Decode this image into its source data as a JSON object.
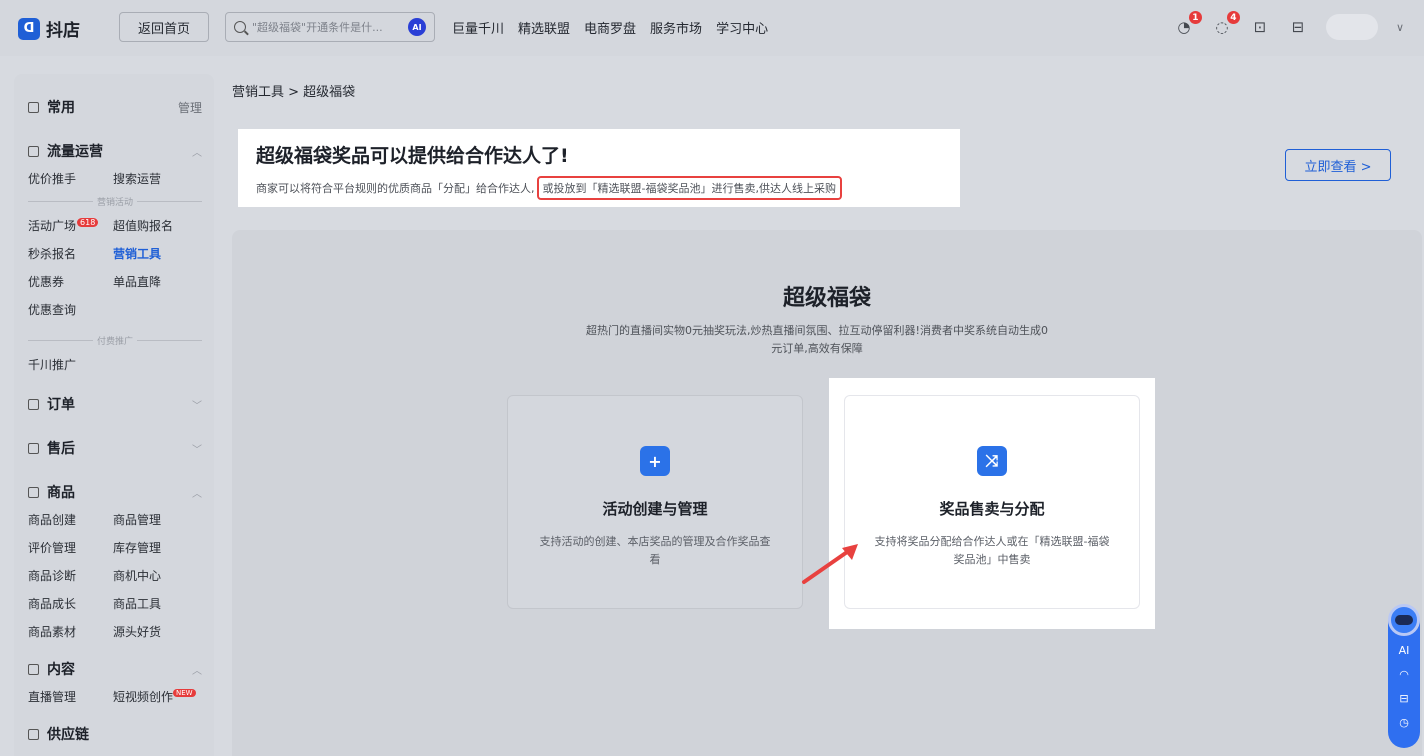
{
  "app": {
    "logo_text": "抖店",
    "logo_mark": "ᗡ",
    "home_label": "返回首页",
    "search_placeholder": "\"超级福袋\"开通条件是什...",
    "ai_label": "AI",
    "topnav": [
      "巨量千川",
      "精选联盟",
      "电商罗盘",
      "服务市场",
      "学习中心"
    ],
    "notification_counts": [
      "1",
      "4"
    ]
  },
  "sidebar": {
    "common": {
      "title": "常用",
      "action": "管理"
    },
    "traffic": {
      "title": "流量运营",
      "row1": [
        "优价推手",
        "搜索运营"
      ],
      "divider1": "营销活动",
      "row2": [
        "活动广场",
        "超值购报名"
      ],
      "badge618": "618",
      "row3": [
        "秒杀报名",
        "营销工具"
      ],
      "row4": [
        "优惠券",
        "单品直降"
      ],
      "row5": [
        "优惠查询"
      ],
      "divider2": "付费推广",
      "row6": [
        "千川推广"
      ]
    },
    "orders": {
      "title": "订单"
    },
    "aftersale": {
      "title": "售后"
    },
    "goods": {
      "title": "商品",
      "items": [
        "商品创建",
        "商品管理",
        "评价管理",
        "库存管理",
        "商品诊断",
        "商机中心",
        "商品成长",
        "商品工具",
        "商品素材",
        "源头好货"
      ]
    },
    "content": {
      "title": "内容",
      "items": [
        "直播管理",
        "短视频创作"
      ],
      "new_badge": "NEW"
    },
    "supply": {
      "title": "供应链"
    }
  },
  "main": {
    "breadcrumb": "营销工具 > 超级福袋",
    "banner": {
      "title": "超级福袋奖品可以提供给合作达人了!",
      "sub_prefix": "商家可以将符合平台规则的优质商品「分配」给合作达人,",
      "sub_highlight": "或投放到「精选联盟-福袋奖品池」进行售卖,供达人线上采购",
      "button": "立即查看 >"
    },
    "panel": {
      "title": "超级福袋",
      "desc": "超热门的直播间实物0元抽奖玩法,炒热直播间氛围、拉互动停留利器!消费者中奖系统自动生成0元订单,高效有保障"
    },
    "cards": [
      {
        "title": "活动创建与管理",
        "desc": "支持活动的创建、本店奖品的管理及合作奖品查看",
        "icon": "+"
      },
      {
        "title": "奖品售卖与分配",
        "desc": "支持将奖品分配给合作达人或在「精选联盟-福袋奖品池」中售卖",
        "icon": "⤨"
      }
    ]
  },
  "floatbar": {
    "ai": "AI"
  },
  "colors": {
    "brand": "#1f5fd6",
    "highlight": "#e8413f",
    "badge": "#e63b3b"
  }
}
